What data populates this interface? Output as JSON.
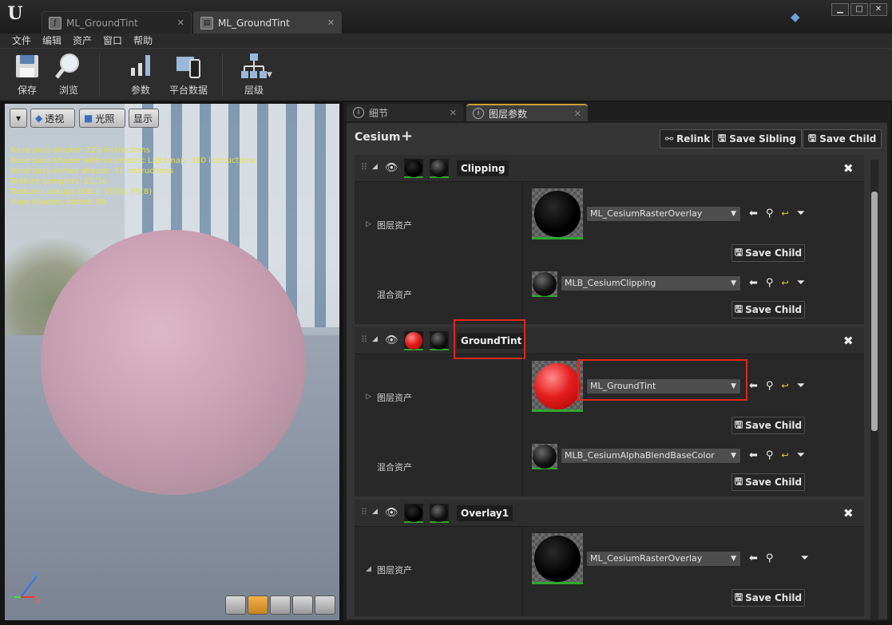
{
  "app": {
    "logo": "U",
    "tabs": [
      {
        "label": "ML_GroundTint",
        "icon": "material-function-icon"
      },
      {
        "label": "ML_GroundTint",
        "icon": "material-layer-icon"
      }
    ],
    "window_controls": [
      "▁",
      "□",
      "✕"
    ]
  },
  "menu": [
    "文件",
    "编辑",
    "资产",
    "窗口",
    "帮助"
  ],
  "toolbar": {
    "save": "保存",
    "browse": "浏览",
    "params": "参数",
    "platform": "平台数据",
    "hierarchy": "层级"
  },
  "viewport": {
    "dropdown": "▾",
    "perspective": "透视",
    "lit": "光照",
    "show": "显示",
    "stats": [
      "Base pass shader: 223 instructions",
      "Base pass shader with Volumetric Lightmap: 310 instructions",
      "Base pass vertex shader: 71 instructions",
      "Texture samplers: 11/16",
      "Texture Lookups (Est.): VS(0), PS(8)",
      "Num shaders added: 96"
    ],
    "axes": {
      "z": "Z",
      "x": "X"
    }
  },
  "panel": {
    "tabs": [
      "细节",
      "图层参数"
    ],
    "title": "Cesium",
    "add": "+",
    "relink": "Relink",
    "save_sibling": "Save Sibling",
    "save_child": "Save Child",
    "row_layer": "图层资产",
    "row_blend": "混合资产",
    "layers": [
      {
        "name": "Clipping",
        "layer_asset": "ML_CesiumRasterOverlay",
        "blend_asset": "MLB_CesiumClipping",
        "save": "Save Child",
        "save2": "Save Child"
      },
      {
        "name": "GroundTint",
        "layer_asset": "ML_GroundTint",
        "blend_asset": "MLB_CesiumAlphaBlendBaseColor",
        "save": "Save Child",
        "save2": "Save Child"
      },
      {
        "name": "Overlay1",
        "layer_asset": "ML_CesiumRasterOverlay",
        "save": "Save Child"
      }
    ]
  },
  "colors": {
    "highlight": "#e0261f",
    "accent": "#c9a23a",
    "sphere": "#c9a0b2"
  }
}
